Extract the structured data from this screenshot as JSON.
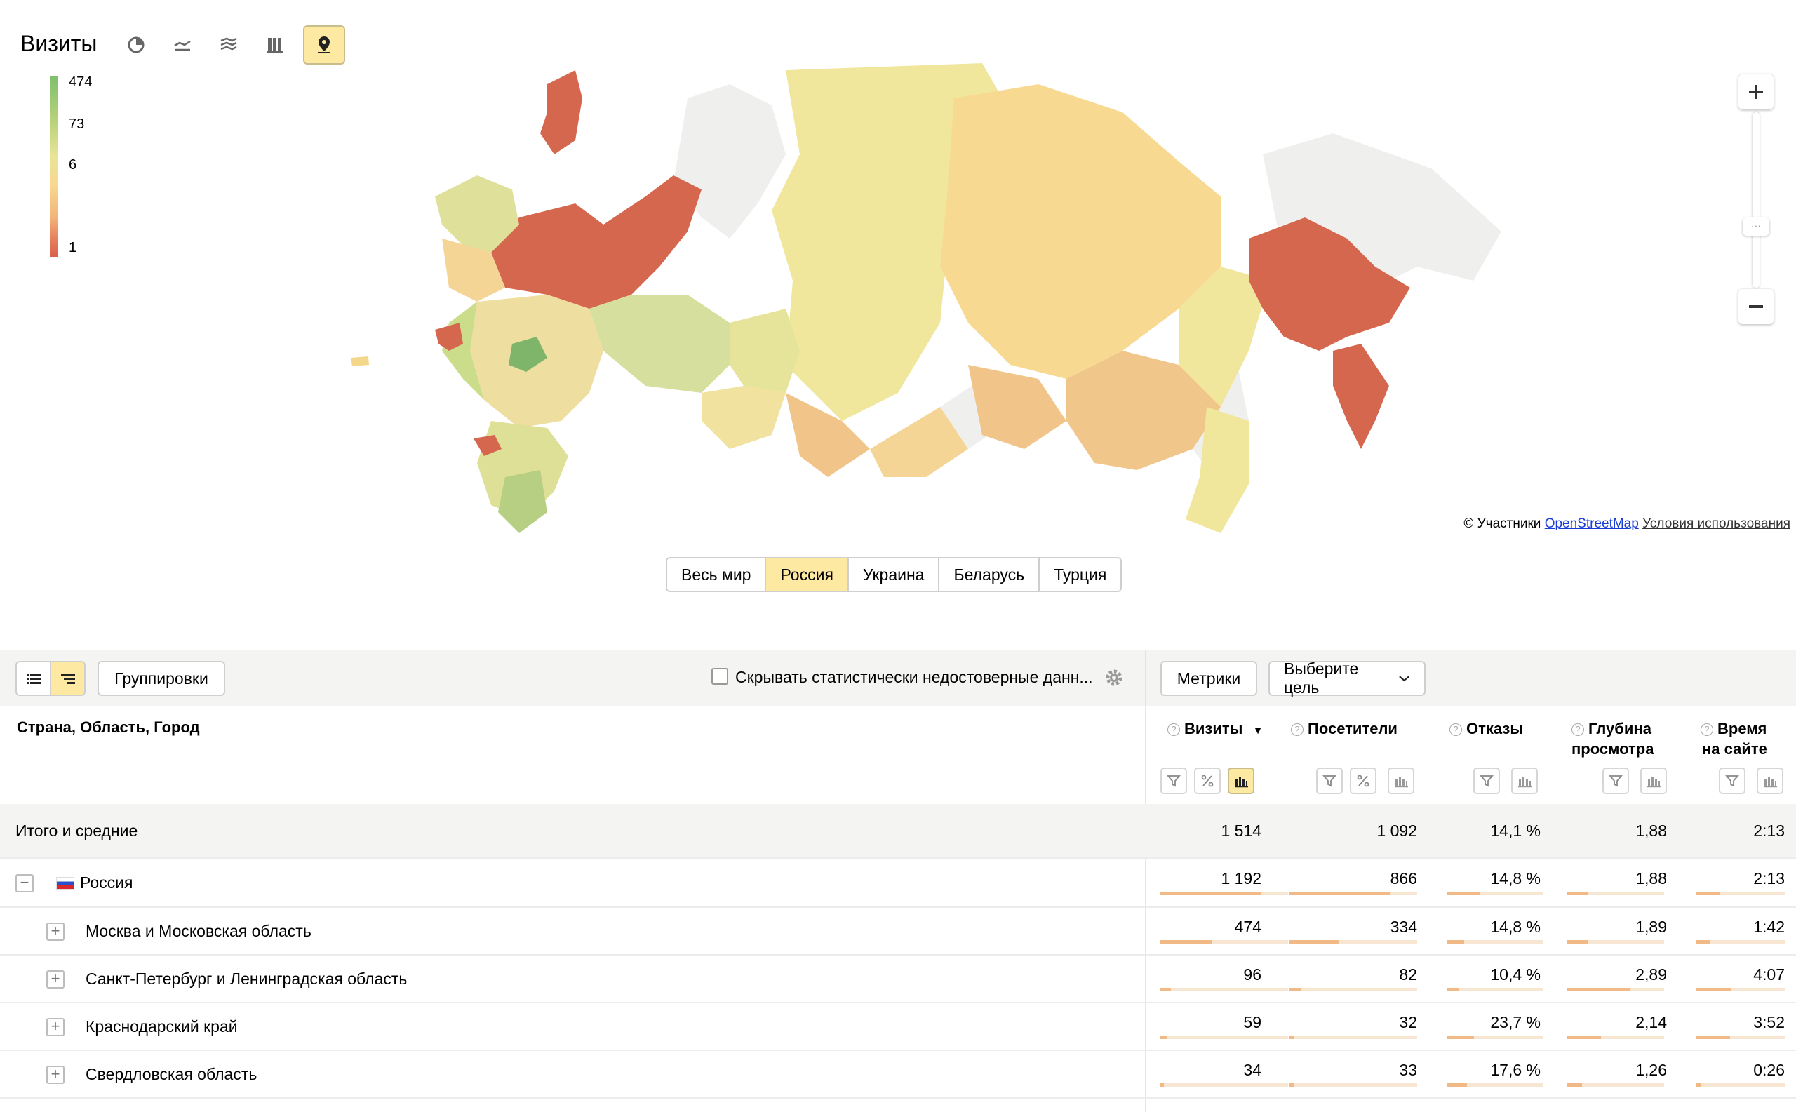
{
  "header": {
    "title": "Визиты",
    "chart_types": [
      "pie-chart-icon",
      "line-chart-icon",
      "area-chart-icon",
      "bar-chart-icon",
      "map-icon"
    ],
    "active_chart": "map-icon"
  },
  "legend": {
    "max": "474",
    "mid": "73",
    "low": "6",
    "min": "1"
  },
  "map": {
    "attribution_prefix": "© Участники",
    "attribution_link": "OpenStreetMap",
    "terms_link": "Условия использования"
  },
  "region_tabs": [
    "Весь мир",
    "Россия",
    "Украина",
    "Беларусь",
    "Турция"
  ],
  "active_region": "Россия",
  "toolbar": {
    "groupings": "Группировки",
    "hide_label": "Скрывать статистически недостоверные данн...",
    "metrics": "Метрики",
    "goal": "Выберите цель"
  },
  "table": {
    "dimension_header": "Страна, Область, Город",
    "columns": [
      {
        "line1": "Визиты",
        "sort": "▼",
        "line2": ""
      },
      {
        "line1": "Посетители",
        "line2": ""
      },
      {
        "line1": "Отказы",
        "line2": ""
      },
      {
        "line1": "Глубина",
        "line2": "просмотра"
      },
      {
        "line1": "Время",
        "line2": "на сайте"
      }
    ],
    "totals": {
      "label": "Итого и средние",
      "values": [
        "1 514",
        "1 092",
        "14,1 %",
        "1,88",
        "2:13"
      ]
    },
    "rows": [
      {
        "label": "Россия",
        "expanded": true,
        "values": [
          "1 192",
          "866",
          "14,8 %",
          "1,88",
          "2:13"
        ],
        "share": [
          0.79,
          0.79,
          0.34,
          0.22,
          0.26
        ]
      },
      {
        "label": "Москва и Московская область",
        "expanded": false,
        "values": [
          "474",
          "334",
          "14,8 %",
          "1,89",
          "1:42"
        ],
        "share": [
          0.4,
          0.39,
          0.18,
          0.22,
          0.15
        ]
      },
      {
        "label": "Санкт-Петербург и Ленинградская область",
        "expanded": false,
        "values": [
          "96",
          "82",
          "10,4 %",
          "2,89",
          "4:07"
        ],
        "share": [
          0.08,
          0.09,
          0.12,
          0.65,
          0.4
        ]
      },
      {
        "label": "Краснодарский край",
        "expanded": false,
        "values": [
          "59",
          "32",
          "23,7 %",
          "2,14",
          "3:52"
        ],
        "share": [
          0.05,
          0.04,
          0.28,
          0.35,
          0.38
        ]
      },
      {
        "label": "Свердловская область",
        "expanded": false,
        "values": [
          "34",
          "33",
          "17,6 %",
          "1,26",
          "0:26"
        ],
        "share": [
          0.03,
          0.04,
          0.21,
          0.15,
          0.05
        ]
      }
    ]
  },
  "colors": {
    "accent": "#fde9a2",
    "bar": "#f0b985",
    "high": "#7fbf6e",
    "low": "#d8614c"
  }
}
